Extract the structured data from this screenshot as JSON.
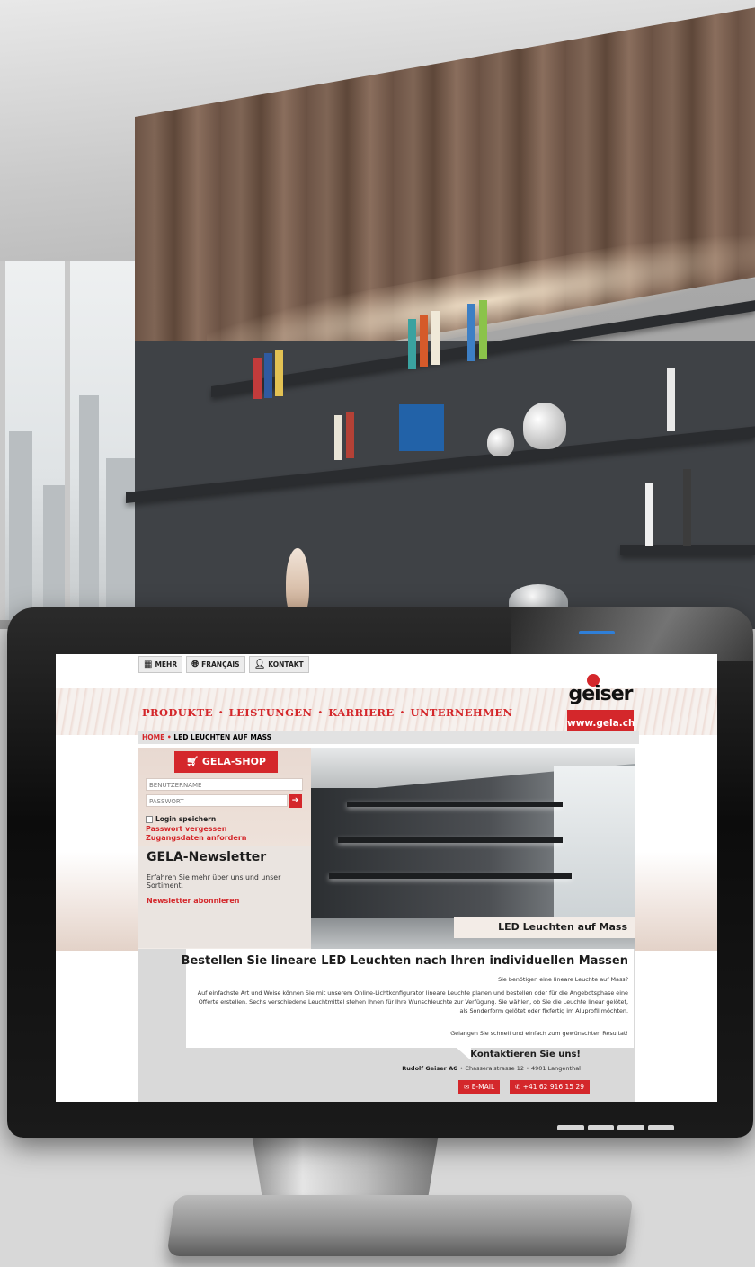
{
  "topbar": {
    "items": [
      {
        "icon": "grid-icon",
        "label": "MEHR"
      },
      {
        "icon": "globe-icon",
        "label": "FRANÇAIS"
      },
      {
        "icon": "person-icon",
        "label": "KONTAKT"
      }
    ]
  },
  "nav": {
    "items": [
      "PRODUKTE",
      "LEISTUNGEN",
      "KARRIERE",
      "UNTERNEHMEN"
    ],
    "separator": "•"
  },
  "logo": {
    "word": "geiser",
    "url": "www.gela.ch"
  },
  "breadcrumb": {
    "home": "HOME",
    "separator": "•",
    "current": "LED LEUCHTEN AUF MASS"
  },
  "shop": {
    "button": "GELA-SHOP",
    "username_placeholder": "BENUTZERNAME",
    "password_placeholder": "PASSWORT",
    "remember": "Login speichern",
    "forgot": "Passwort vergessen",
    "request": "Zugangsdaten anfordern"
  },
  "newsletter": {
    "title": "GELA-Newsletter",
    "text": "Erfahren Sie mehr über uns und unser Sortiment.",
    "link": "Newsletter abonnieren"
  },
  "hero": {
    "caption": "LED Leuchten auf Mass"
  },
  "article": {
    "title": "Bestellen Sie lineare LED Leuchten nach Ihren individuellen Massen",
    "question": "Sie benötigen eine lineare Leuchte auf Mass?",
    "body": "Auf einfachste Art und Weise können Sie mit unserem Online-Lichtkonfigurator lineare Leuchte planen und bestellen oder für die Angebotsphase eine Offerte erstellen. Sechs verschiedene Leuchtmittel stehen Ihnen für Ihre Wunschleuchte zur Verfügung. Sie wählen, ob Sie die Leuchte linear gelötet, als Sonderform gelötet oder fixfertig im Aluprofil möchten.",
    "closing": "Gelangen Sie schnell und einfach zum gewünschten Resultat!"
  },
  "contact": {
    "title": "Kontaktieren Sie uns!",
    "company": "Rudolf Geiser AG",
    "address": "• Chasseralstrasse 12 • 4901 Langenthal",
    "email_label": "E-MAIL",
    "phone_label": "+41 62 916 15 29"
  },
  "colors": {
    "brand_red": "#d4272b",
    "wood": "#7a6051",
    "wall": "#3f4246"
  }
}
